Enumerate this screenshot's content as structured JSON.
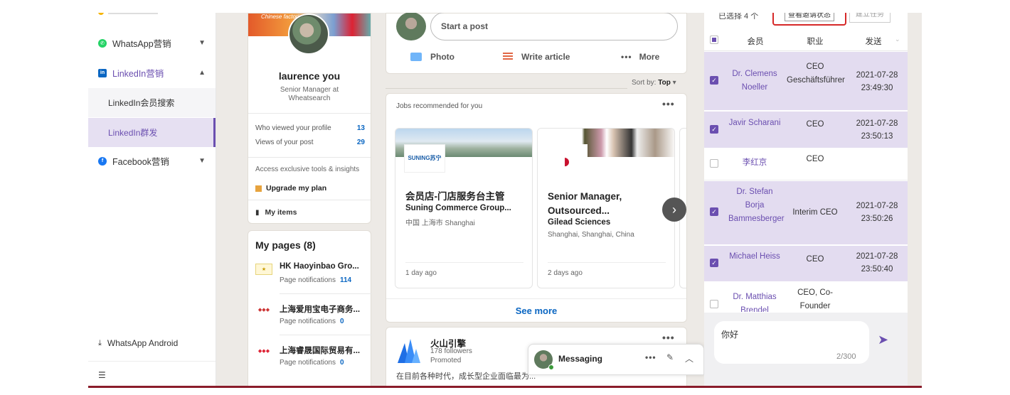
{
  "sidebar": {
    "items": [
      {
        "label": "WhatsApp营销",
        "color": "#25d366",
        "expanded": false
      },
      {
        "label": "LinkedIn营销",
        "color": "#0a66c2",
        "expanded": true
      },
      {
        "label": "Facebook营销",
        "color": "#1877f2",
        "expanded": false
      }
    ],
    "sub_items": [
      "LinkedIn会员搜索",
      "LinkedIn群发"
    ],
    "bottom_label": "WhatsApp Android"
  },
  "profile": {
    "name": "laurence you",
    "title": "Senior Manager at Wheatsearch",
    "cover_tag": "Chinese factories",
    "stats": [
      {
        "label": "Who viewed your profile",
        "value": "13"
      },
      {
        "label": "Views of your post",
        "value": "29"
      }
    ],
    "access_text": "Access exclusive tools & insights",
    "upgrade_label": "Upgrade my plan",
    "my_items_label": "My items"
  },
  "pages": {
    "title": "My pages (8)",
    "items": [
      {
        "name": "HK Haoyinbao Gro...",
        "notif_label": "Page notifications",
        "count": "114"
      },
      {
        "name": "上海爱用宝电子商务...",
        "notif_label": "Page notifications",
        "count": "0"
      },
      {
        "name": "上海睿晟国际贸易有...",
        "notif_label": "Page notifications",
        "count": "0"
      }
    ]
  },
  "feed": {
    "start_post_placeholder": "Start a post",
    "actions": [
      "Photo",
      "Write article",
      "More"
    ],
    "sort_label": "Sort by:",
    "sort_value": "Top"
  },
  "jobs": {
    "title": "Jobs recommended for you",
    "items": [
      {
        "title": "会员店-门店服务台主管",
        "company": "Suning Commerce Group...",
        "location": "中国 上海市 Shanghai",
        "time": "1 day ago",
        "logo_text": "SUNING苏宁"
      },
      {
        "title": "Senior Manager, Outsourced...",
        "company": "Gilead Sciences",
        "location": "Shanghai, Shanghai, China",
        "time": "2 days ago"
      }
    ],
    "see_more": "See more"
  },
  "promo": {
    "name": "火山引擎",
    "followers": "178 followers",
    "promoted": "Promoted",
    "text": "在目前各种时代，成长型企业面临最为..."
  },
  "messaging": {
    "label": "Messaging"
  },
  "right_panel": {
    "selected_text": "已选择 4 个",
    "view_button": "查看邀请状态",
    "task_button": "建立任务",
    "headers": {
      "member": "会员",
      "job": "职业",
      "send": "发送"
    },
    "rows": [
      {
        "member": "Dr. Clemens Noeller",
        "job": "CEO Geschäftsführer",
        "send": "2021-07-28 23:49:30",
        "selected": true
      },
      {
        "member": "Javir Scharani",
        "job": "CEO",
        "send": "2021-07-28 23:50:13",
        "selected": true
      },
      {
        "member": "李红京",
        "job": "CEO",
        "send": "",
        "selected": false
      },
      {
        "member": "Dr. Stefan Borja Bammesberger",
        "job": "Interim CEO",
        "send": "2021-07-28 23:50:26",
        "selected": true
      },
      {
        "member": "Michael Heiss",
        "job": "CEO",
        "send": "2021-07-28 23:50:40",
        "selected": true
      },
      {
        "member": "Dr. Matthias Brendel",
        "job": "CEO, Co-Founder",
        "send": "",
        "selected": false
      }
    ],
    "message_value": "你好",
    "message_count": "2/300"
  },
  "colors": {
    "accent": "#6b4fb0",
    "linkedin": "#0a66c2",
    "highlight": "#d62828"
  }
}
